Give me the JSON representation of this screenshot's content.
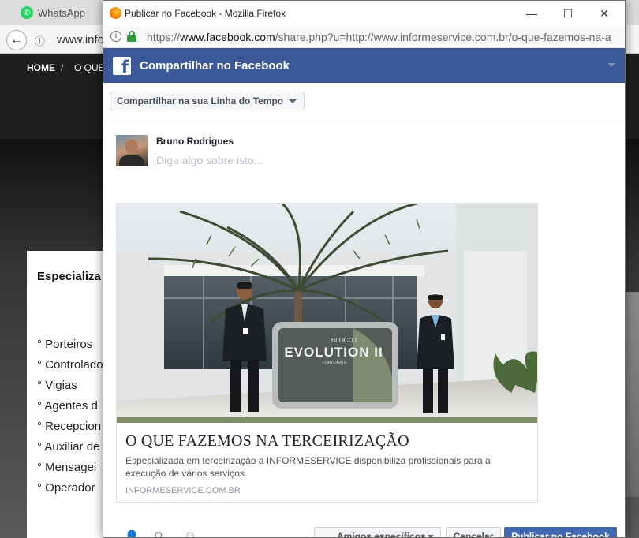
{
  "background": {
    "tab_label": "WhatsApp",
    "url_partial": "www.info",
    "nav": {
      "home": "HOME",
      "separator": "/",
      "next": "O QUE"
    },
    "card": {
      "title": "Especializa profissiona",
      "items": [
        "° Porteiros",
        "° Controlado",
        "° Vigias",
        "° Agentes d",
        "° Recepcion",
        "° Auxiliar de",
        "° Mensagei",
        "° Operador"
      ]
    }
  },
  "window": {
    "title": "Publicar no Facebook - Mozilla Firefox",
    "minimize": "—",
    "maximize": "☐",
    "close": "✕"
  },
  "urlbar": {
    "info_icon": "i",
    "scheme": "https://",
    "host": "www.facebook.com",
    "path": "/share.php?u=http://www.informeservice.com.br/o-que-fazemos-na-a"
  },
  "facebook": {
    "logo": "f",
    "header_title": "Compartilhar no Facebook",
    "share_target": "Compartilhar na sua Linha do Tempo",
    "user_name": "Bruno Rodrigues",
    "post_placeholder": "Diga algo sobre isto...",
    "preview": {
      "sign_line1": "BLOCO I",
      "sign_line2": "EVOLUTION II",
      "sign_line3": "CORPORATE",
      "title": "O QUE FAZEMOS NA TERCEIRIZAÇÃO",
      "description": "Especializada em terceirização a INFORMESERVICE disponibiliza profissionais para a execução de vários serviços.",
      "domain": "INFORMESERVICE.COM.BR"
    },
    "footer": {
      "audience_label": "Amigos específicos",
      "cancel_label": "Cancelar",
      "publish_label": "Publicar no Facebook"
    }
  },
  "colors": {
    "facebook_blue": "#3b5998",
    "publish_blue": "#4267b2"
  }
}
